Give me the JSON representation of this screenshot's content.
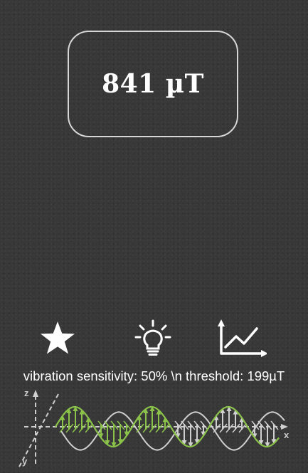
{
  "reading": {
    "value_text": "841 µT"
  },
  "toolbar": {
    "buttons": [
      {
        "icon": "star-icon"
      },
      {
        "icon": "lightbulb-icon"
      },
      {
        "icon": "line-chart-icon"
      }
    ]
  },
  "status": {
    "text": "vibration sensitivity: 50% \\n threshold: 199µT"
  },
  "illustration": {
    "axis_labels": {
      "z": "z",
      "y": "y",
      "x": "x"
    },
    "colors": {
      "wave_primary": "#8bc34a",
      "wave_secondary": "#cfcfcf",
      "axes": "#cfcfcf"
    }
  },
  "colors": {
    "background": "#383838",
    "text": "#ffffff",
    "box_border": "#d6d6d6"
  }
}
